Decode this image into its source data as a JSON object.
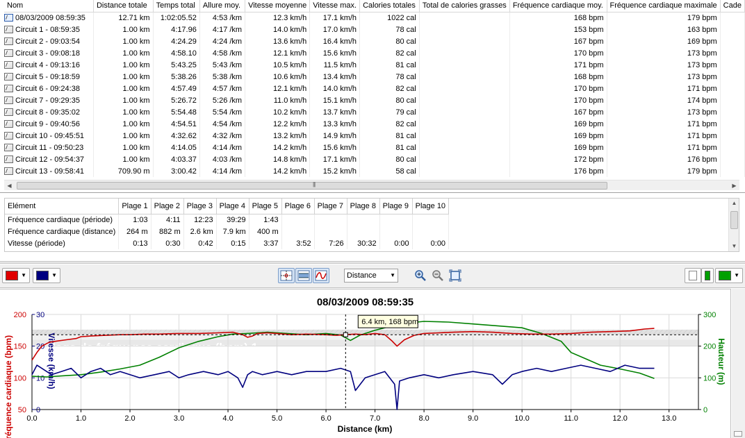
{
  "laps": {
    "columns": [
      "Nom",
      "Distance totale",
      "Temps total",
      "Allure moy.",
      "Vitesse moyenne",
      "Vitesse max.",
      "Calories totales",
      "Total de calories grasses",
      "Fréquence cardiaque moy.",
      "Fréquence cardiaque maximale",
      "Cade"
    ],
    "rows": [
      {
        "icon": "total-run-icon",
        "name": "08/03/2009 08:59:35",
        "distance": "12.71 km",
        "time": "1:02:05.52",
        "pace": "4:53 /km",
        "avg_speed": "12.3 km/h",
        "max_speed": "17.1 km/h",
        "calories": "1022 cal",
        "fat_calories": "",
        "avg_hr": "168 bpm",
        "max_hr": "179 bpm",
        "cadence": ""
      },
      {
        "icon": "lap-icon",
        "name": "Circuit 1 - 08:59:35",
        "distance": "1.00 km",
        "time": "4:17.96",
        "pace": "4:17 /km",
        "avg_speed": "14.0 km/h",
        "max_speed": "17.0 km/h",
        "calories": "78 cal",
        "fat_calories": "",
        "avg_hr": "153 bpm",
        "max_hr": "163 bpm",
        "cadence": ""
      },
      {
        "icon": "lap-icon",
        "name": "Circuit 2 - 09:03:54",
        "distance": "1.00 km",
        "time": "4:24.29",
        "pace": "4:24 /km",
        "avg_speed": "13.6 km/h",
        "max_speed": "16.4 km/h",
        "calories": "80 cal",
        "fat_calories": "",
        "avg_hr": "167 bpm",
        "max_hr": "169 bpm",
        "cadence": ""
      },
      {
        "icon": "lap-icon",
        "name": "Circuit 3 - 09:08:18",
        "distance": "1.00 km",
        "time": "4:58.10",
        "pace": "4:58 /km",
        "avg_speed": "12.1 km/h",
        "max_speed": "15.6 km/h",
        "calories": "82 cal",
        "fat_calories": "",
        "avg_hr": "170 bpm",
        "max_hr": "173 bpm",
        "cadence": ""
      },
      {
        "icon": "lap-icon",
        "name": "Circuit 4 - 09:13:16",
        "distance": "1.00 km",
        "time": "5:43.25",
        "pace": "5:43 /km",
        "avg_speed": "10.5 km/h",
        "max_speed": "11.5 km/h",
        "calories": "81 cal",
        "fat_calories": "",
        "avg_hr": "171 bpm",
        "max_hr": "173 bpm",
        "cadence": ""
      },
      {
        "icon": "lap-icon",
        "name": "Circuit 5 - 09:18:59",
        "distance": "1.00 km",
        "time": "5:38.26",
        "pace": "5:38 /km",
        "avg_speed": "10.6 km/h",
        "max_speed": "13.4 km/h",
        "calories": "78 cal",
        "fat_calories": "",
        "avg_hr": "168 bpm",
        "max_hr": "173 bpm",
        "cadence": ""
      },
      {
        "icon": "lap-icon",
        "name": "Circuit 6 - 09:24:38",
        "distance": "1.00 km",
        "time": "4:57.49",
        "pace": "4:57 /km",
        "avg_speed": "12.1 km/h",
        "max_speed": "14.0 km/h",
        "calories": "82 cal",
        "fat_calories": "",
        "avg_hr": "170 bpm",
        "max_hr": "171 bpm",
        "cadence": ""
      },
      {
        "icon": "lap-icon",
        "name": "Circuit 7 - 09:29:35",
        "distance": "1.00 km",
        "time": "5:26.72",
        "pace": "5:26 /km",
        "avg_speed": "11.0 km/h",
        "max_speed": "15.1 km/h",
        "calories": "80 cal",
        "fat_calories": "",
        "avg_hr": "170 bpm",
        "max_hr": "174 bpm",
        "cadence": ""
      },
      {
        "icon": "lap-icon",
        "name": "Circuit 8 - 09:35:02",
        "distance": "1.00 km",
        "time": "5:54.48",
        "pace": "5:54 /km",
        "avg_speed": "10.2 km/h",
        "max_speed": "13.7 km/h",
        "calories": "79 cal",
        "fat_calories": "",
        "avg_hr": "167 bpm",
        "max_hr": "173 bpm",
        "cadence": ""
      },
      {
        "icon": "lap-icon",
        "name": "Circuit 9 - 09:40:56",
        "distance": "1.00 km",
        "time": "4:54.51",
        "pace": "4:54 /km",
        "avg_speed": "12.2 km/h",
        "max_speed": "13.3 km/h",
        "calories": "82 cal",
        "fat_calories": "",
        "avg_hr": "169 bpm",
        "max_hr": "171 bpm",
        "cadence": ""
      },
      {
        "icon": "lap-icon",
        "name": "Circuit 10 - 09:45:51",
        "distance": "1.00 km",
        "time": "4:32.62",
        "pace": "4:32 /km",
        "avg_speed": "13.2 km/h",
        "max_speed": "14.9 km/h",
        "calories": "81 cal",
        "fat_calories": "",
        "avg_hr": "169 bpm",
        "max_hr": "171 bpm",
        "cadence": ""
      },
      {
        "icon": "lap-icon",
        "name": "Circuit 11 - 09:50:23",
        "distance": "1.00 km",
        "time": "4:14.05",
        "pace": "4:14 /km",
        "avg_speed": "14.2 km/h",
        "max_speed": "15.6 km/h",
        "calories": "81 cal",
        "fat_calories": "",
        "avg_hr": "169 bpm",
        "max_hr": "171 bpm",
        "cadence": ""
      },
      {
        "icon": "lap-icon",
        "name": "Circuit 12 - 09:54:37",
        "distance": "1.00 km",
        "time": "4:03.37",
        "pace": "4:03 /km",
        "avg_speed": "14.8 km/h",
        "max_speed": "17.1 km/h",
        "calories": "80 cal",
        "fat_calories": "",
        "avg_hr": "172 bpm",
        "max_hr": "176 bpm",
        "cadence": ""
      },
      {
        "icon": "lap-icon",
        "name": "Circuit 13 - 09:58:41",
        "distance": "709.90 m",
        "time": "3:00.42",
        "pace": "4:14 /km",
        "avg_speed": "14.2 km/h",
        "max_speed": "15.2 km/h",
        "calories": "58 cal",
        "fat_calories": "",
        "avg_hr": "176 bpm",
        "max_hr": "179 bpm",
        "cadence": ""
      }
    ]
  },
  "zones": {
    "columns": [
      "Elément",
      "Plage 1",
      "Plage 2",
      "Plage 3",
      "Plage 4",
      "Plage 5",
      "Plage 6",
      "Plage 7",
      "Plage 8",
      "Plage 9",
      "Plage 10"
    ],
    "rows": [
      {
        "label": "Fréquence cardiaque (période)",
        "values": [
          "1:03",
          "4:11",
          "12:23",
          "39:29",
          "1:43",
          "",
          "",
          "",
          "",
          ""
        ]
      },
      {
        "label": "Fréquence cardiaque (distance)",
        "values": [
          "264 m",
          "882 m",
          "2.6 km",
          "7.9 km",
          "400 m",
          "",
          "",
          "",
          "",
          ""
        ]
      },
      {
        "label": "Vitesse (période)",
        "values": [
          "0:13",
          "0:30",
          "0:42",
          "0:15",
          "3:37",
          "3:52",
          "7:26",
          "30:32",
          "0:00",
          "0:00"
        ]
      }
    ]
  },
  "toolbar": {
    "left_color_1": "#e00000",
    "left_color_2": "#000080",
    "x_axis_select": "Distance",
    "right_color": "#00a000",
    "icons": [
      "crosshair-icon",
      "range-icon",
      "smooth-icon",
      "zoom-in-icon",
      "zoom-out-icon",
      "fit-icon"
    ]
  },
  "chart_data": {
    "type": "line",
    "title": "08/03/2009 08:59:35",
    "xlabel": "Distance (km)",
    "xlim": [
      0,
      13.6
    ],
    "xticks": [
      "0.0",
      "1.0",
      "2.0",
      "3.0",
      "4.0",
      "5.0",
      "6.0",
      "7.0",
      "8.0",
      "9.0",
      "10.0",
      "11.0",
      "12.0",
      "13.0"
    ],
    "grid": true,
    "zone_label": "Plage de fréquence cardiaque (bpm) 1",
    "tooltip": "6.4 km, 168 bpm",
    "cursor_x": 6.4,
    "cursor_y_hr": 168,
    "axes": {
      "hr": {
        "label": "Fréquence cardiaque (bpm)",
        "color": "#cc0000",
        "range": [
          50,
          200
        ],
        "ticks": [
          "50",
          "100",
          "150",
          "200"
        ]
      },
      "speed": {
        "label": "Vitesse (km/h)",
        "color": "#00007f",
        "range": [
          0,
          30
        ],
        "ticks": [
          "0",
          "10",
          "20",
          "30"
        ]
      },
      "altitude": {
        "label": "Hauteur (m)",
        "color": "#008000",
        "range": [
          0,
          300
        ],
        "ticks": [
          "0",
          "100",
          "200",
          "300"
        ]
      }
    },
    "zone_bands_hr": [
      [
        150,
        160
      ],
      [
        160,
        168
      ],
      [
        168,
        176
      ]
    ],
    "series": [
      {
        "name": "Fréquence cardiaque (bpm)",
        "axis": "hr",
        "color": "#cc0000",
        "x": [
          0,
          0.1,
          0.2,
          0.35,
          0.5,
          0.7,
          0.9,
          1.0,
          1.2,
          1.5,
          1.8,
          2.0,
          2.3,
          2.6,
          3.0,
          3.4,
          3.8,
          4.1,
          4.3,
          4.4,
          4.5,
          4.6,
          4.8,
          5.0,
          5.3,
          5.6,
          6.0,
          6.2,
          6.4,
          6.6,
          6.8,
          7.0,
          7.2,
          7.35,
          7.45,
          7.6,
          7.8,
          8.0,
          8.3,
          8.6,
          9.0,
          9.4,
          9.8,
          10.2,
          10.6,
          11.0,
          11.4,
          11.8,
          12.2,
          12.5,
          12.7
        ],
        "y": [
          128,
          140,
          150,
          156,
          158,
          160,
          162,
          165,
          166,
          167,
          168,
          168,
          169,
          169,
          170,
          170,
          171,
          172,
          168,
          164,
          166,
          170,
          171,
          170,
          168,
          169,
          168,
          167,
          168,
          169,
          168,
          170,
          168,
          158,
          150,
          160,
          167,
          170,
          171,
          172,
          173,
          172,
          170,
          169,
          169,
          170,
          172,
          173,
          174,
          177,
          178
        ]
      },
      {
        "name": "Vitesse (km/h)",
        "axis": "speed",
        "color": "#00007f",
        "x": [
          0,
          0.1,
          0.2,
          0.4,
          0.6,
          0.8,
          1.0,
          1.2,
          1.4,
          1.6,
          1.8,
          2.0,
          2.2,
          2.5,
          2.8,
          3.0,
          3.2,
          3.5,
          3.8,
          4.0,
          4.2,
          4.3,
          4.4,
          4.5,
          4.7,
          5.0,
          5.3,
          5.6,
          6.0,
          6.3,
          6.5,
          6.6,
          6.8,
          7.0,
          7.2,
          7.4,
          7.45,
          7.5,
          7.7,
          8.0,
          8.3,
          8.6,
          9.0,
          9.4,
          9.6,
          9.8,
          10.0,
          10.3,
          10.6,
          10.9,
          11.2,
          11.5,
          11.8,
          12.1,
          12.4,
          12.7
        ],
        "y": [
          11,
          14,
          13,
          11,
          12,
          13,
          10,
          12,
          13,
          11,
          12,
          11,
          10,
          11,
          12,
          10,
          11,
          12,
          11,
          12,
          10,
          7,
          11,
          12,
          11,
          12,
          11,
          12,
          12,
          13,
          12,
          6,
          10,
          11,
          12,
          8,
          0,
          9,
          10,
          11,
          10,
          11,
          12,
          11,
          8,
          11,
          12,
          13,
          12,
          13,
          14,
          13,
          12,
          14,
          13,
          13
        ]
      },
      {
        "name": "Hauteur (m)",
        "axis": "altitude",
        "color": "#008000",
        "x": [
          0,
          0.3,
          0.6,
          1.0,
          1.4,
          1.8,
          2.2,
          2.6,
          3.0,
          3.4,
          3.8,
          4.1,
          4.4,
          4.8,
          5.2,
          5.6,
          6.0,
          6.3,
          6.5,
          6.7,
          7.0,
          7.3,
          7.6,
          8.0,
          8.5,
          9.0,
          9.5,
          10.0,
          10.4,
          10.8,
          11.0,
          11.3,
          11.6,
          12.0,
          12.4,
          12.7
        ],
        "y": [
          105,
          103,
          106,
          110,
          118,
          128,
          140,
          165,
          195,
          215,
          230,
          238,
          240,
          244,
          240,
          236,
          240,
          235,
          218,
          235,
          250,
          262,
          272,
          278,
          276,
          270,
          264,
          258,
          240,
          215,
          180,
          160,
          140,
          128,
          115,
          98
        ]
      }
    ]
  }
}
